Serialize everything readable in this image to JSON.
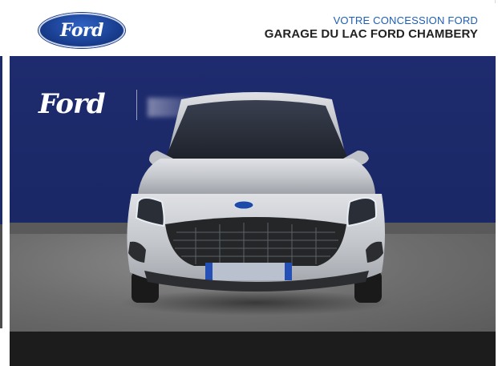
{
  "header": {
    "brand_logo_text": "Ford",
    "dealer_tagline": "VOTRE CONCESSION FORD",
    "dealer_name": "GARAGE DU LAC FORD CHAMBERY"
  },
  "photo": {
    "wall_logo_text": "Ford",
    "grille_badge_text": "Ford",
    "license_plate_blurred": true
  },
  "colors": {
    "ford_blue": "#1a3f91",
    "tagline_blue": "#1d5fb8",
    "wall_navy": "#1e2b6e",
    "car_silver": "#c4c7cc",
    "bottom_bar": "#1c1c1c"
  }
}
